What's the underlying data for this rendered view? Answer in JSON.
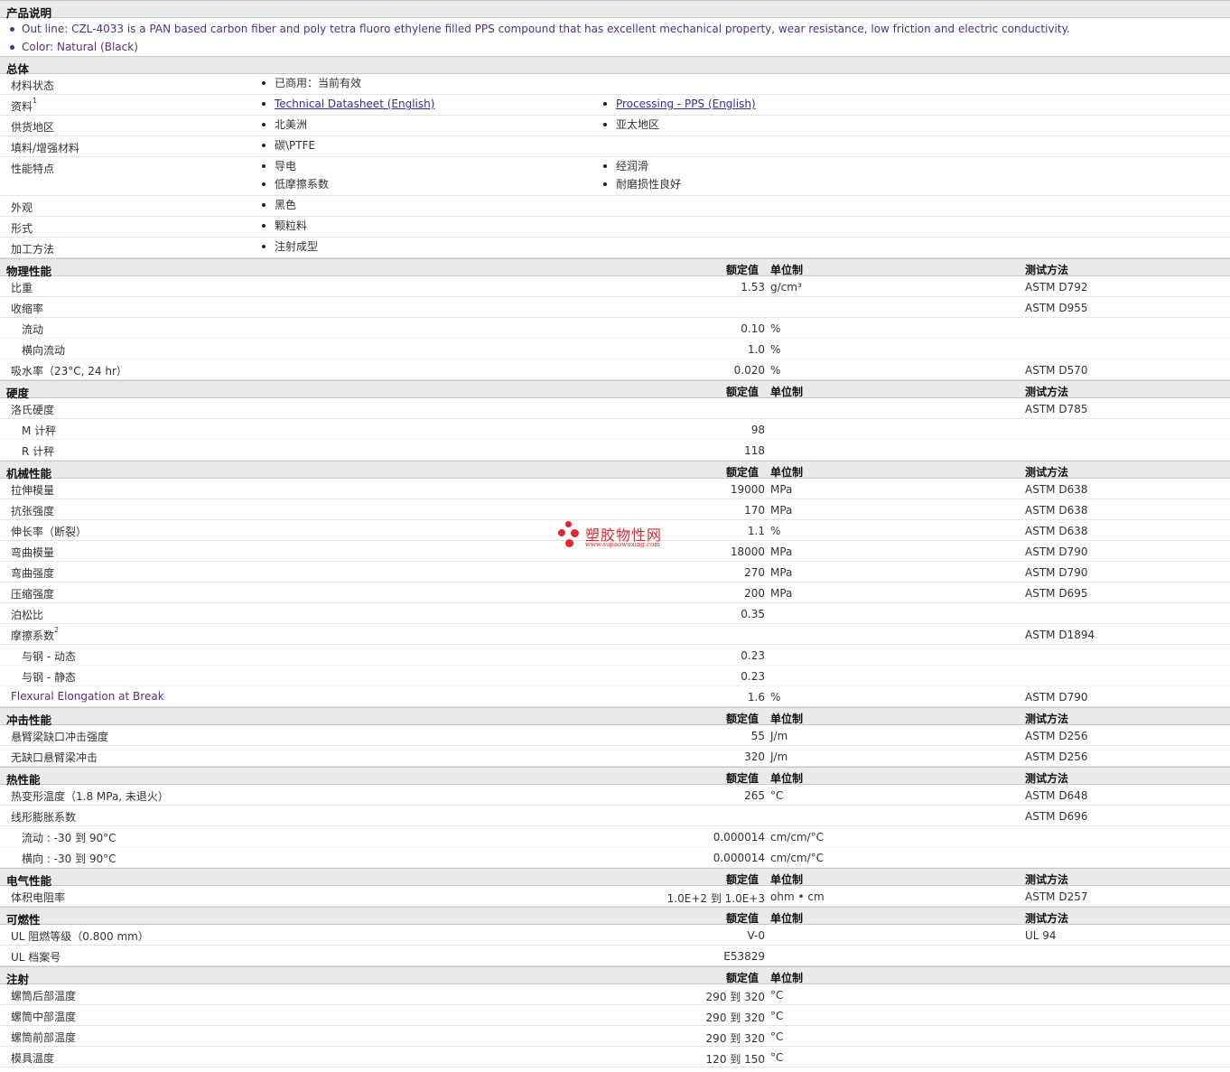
{
  "overview": {
    "title": "产品说明",
    "items": [
      "Out line: CZL-4033 is a PAN based carbon fiber and poly tetra fluoro ethylene filled PPS compound that has excellent mechanical property, wear resistance, low friction and electric conductivity.",
      "Color: Natural (Black)"
    ]
  },
  "general": {
    "title": "总体",
    "rows": [
      {
        "label": "材料状态",
        "col1": [
          "已商用：当前有效"
        ],
        "col2": []
      },
      {
        "label": "资料",
        "sup": "1",
        "col1": [
          "Technical Datasheet (English)"
        ],
        "col2": [
          "Processing - PPS (English)"
        ],
        "links": true
      },
      {
        "label": "供货地区",
        "col1": [
          "北美洲"
        ],
        "col2": [
          "亚太地区"
        ]
      },
      {
        "label": "填料/增强材料",
        "col1": [
          "碳\\PTFE"
        ],
        "col2": []
      },
      {
        "label": "性能特点",
        "col1": [
          "导电",
          "低摩擦系数"
        ],
        "col2": [
          "经润滑",
          "耐磨损性良好"
        ],
        "tall": true
      },
      {
        "label": "外观",
        "col1": [
          "黑色"
        ],
        "col2": []
      },
      {
        "label": "形式",
        "col1": [
          "颗粒料"
        ],
        "col2": []
      },
      {
        "label": "加工方法",
        "col1": [
          "注射成型"
        ],
        "col2": []
      }
    ]
  },
  "column_headers": {
    "value": "额定值",
    "unit": "单位制",
    "method": "测试方法"
  },
  "sections": [
    {
      "title": "物理性能",
      "method_header": true,
      "rows": [
        {
          "label": "比重",
          "value": "1.53",
          "unit": "g/cm³",
          "method": "ASTM D792"
        },
        {
          "label": "收缩率",
          "value": "",
          "unit": "",
          "method": "ASTM D955"
        },
        {
          "label": "流动",
          "value": "0.10",
          "unit": "%",
          "method": "",
          "sub": true
        },
        {
          "label": "横向流动",
          "value": "1.0",
          "unit": "%",
          "method": "",
          "sub": true
        },
        {
          "label": "吸水率（23°C, 24 hr）",
          "value": "0.020",
          "unit": "%",
          "method": "ASTM D570"
        }
      ]
    },
    {
      "title": "硬度",
      "method_header": true,
      "rows": [
        {
          "label": "洛氏硬度",
          "value": "",
          "unit": "",
          "method": "ASTM D785"
        },
        {
          "label": "M 计秤",
          "value": "98",
          "unit": "",
          "method": "",
          "sub": true
        },
        {
          "label": "R 计秤",
          "value": "118",
          "unit": "",
          "method": "",
          "sub": true
        }
      ]
    },
    {
      "title": "机械性能",
      "method_header": true,
      "rows": [
        {
          "label": "拉伸模量",
          "value": "19000",
          "unit": "MPa",
          "method": "ASTM D638"
        },
        {
          "label": "抗张强度",
          "value": "170",
          "unit": "MPa",
          "method": "ASTM D638"
        },
        {
          "label": "伸长率（断裂）",
          "value": "1.1",
          "unit": "%",
          "method": "ASTM D638"
        },
        {
          "label": "弯曲模量",
          "value": "18000",
          "unit": "MPa",
          "method": "ASTM D790"
        },
        {
          "label": "弯曲强度",
          "value": "270",
          "unit": "MPa",
          "method": "ASTM D790"
        },
        {
          "label": "压缩强度",
          "value": "200",
          "unit": "MPa",
          "method": "ASTM D695"
        },
        {
          "label": "泊松比",
          "value": "0.35",
          "unit": "",
          "method": ""
        },
        {
          "label": "摩擦系数",
          "sup": "2",
          "value": "",
          "unit": "",
          "method": "ASTM D1894"
        },
        {
          "label": "与钢 - 动态",
          "value": "0.23",
          "unit": "",
          "method": "",
          "sub": true
        },
        {
          "label": "与钢 - 静态",
          "value": "0.23",
          "unit": "",
          "method": "",
          "sub": true
        },
        {
          "label": "Flexural Elongation at Break",
          "value": "1.6",
          "unit": "%",
          "method": "ASTM D790",
          "purple": true
        }
      ]
    },
    {
      "title": "冲击性能",
      "method_header": true,
      "rows": [
        {
          "label": "悬臂梁缺口冲击强度",
          "value": "55",
          "unit": "J/m",
          "method": "ASTM D256"
        },
        {
          "label": "无缺口悬臂梁冲击",
          "value": "320",
          "unit": "J/m",
          "method": "ASTM D256"
        }
      ]
    },
    {
      "title": "热性能",
      "method_header": true,
      "rows": [
        {
          "label": "热变形温度（1.8 MPa, 未退火）",
          "value": "265",
          "unit": "°C",
          "method": "ASTM D648"
        },
        {
          "label": "线形膨胀系数",
          "value": "",
          "unit": "",
          "method": "ASTM D696"
        },
        {
          "label": "流动 : -30 到 90°C",
          "value": "0.000014",
          "unit": "cm/cm/°C",
          "method": "",
          "sub": true
        },
        {
          "label": "横向 : -30 到 90°C",
          "value": "0.000014",
          "unit": "cm/cm/°C",
          "method": "",
          "sub": true
        }
      ]
    },
    {
      "title": "电气性能",
      "method_header": true,
      "rows": [
        {
          "label": "体积电阻率",
          "value": "1.0E+2 到 1.0E+3",
          "unit": "ohm • cm",
          "method": "ASTM D257"
        }
      ]
    },
    {
      "title": "可燃性",
      "method_header": true,
      "rows": [
        {
          "label": "UL 阻燃等级（0.800 mm）",
          "value": "V-0",
          "unit": "",
          "method": "UL 94"
        },
        {
          "label": "UL 档案号",
          "value": "E53829",
          "unit": "",
          "method": ""
        }
      ]
    },
    {
      "title": "注射",
      "method_header": false,
      "rows": [
        {
          "label": "螺筒后部温度",
          "value": "290 到 320",
          "unit": "°C",
          "method": ""
        },
        {
          "label": "螺筒中部温度",
          "value": "290 到 320",
          "unit": "°C",
          "method": ""
        },
        {
          "label": "螺筒前部温度",
          "value": "290 到 320",
          "unit": "°C",
          "method": ""
        },
        {
          "label": "模具温度",
          "value": "120 到 150",
          "unit": "°C",
          "method": ""
        }
      ]
    }
  ],
  "watermark": {
    "name": "塑胶物性网",
    "url": "www.sujiaowuxing.com"
  }
}
